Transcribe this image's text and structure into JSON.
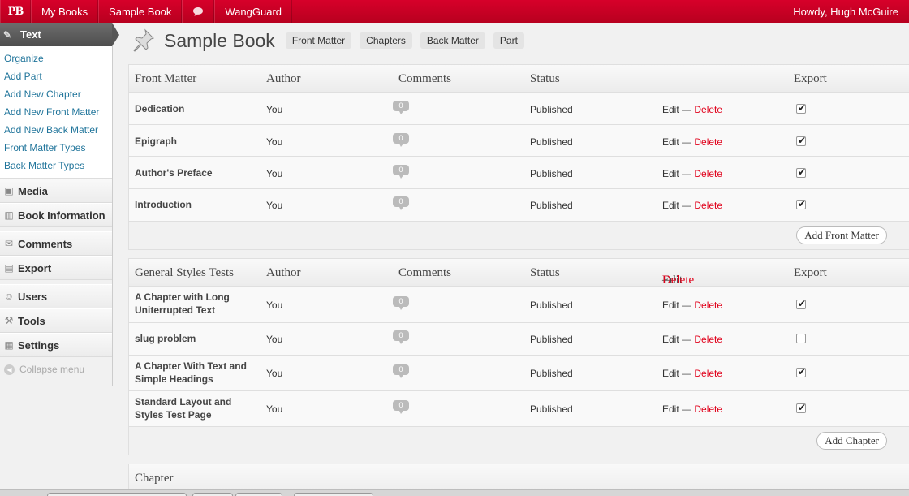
{
  "adminbar": {
    "logo": "PB",
    "my_books": "My Books",
    "sample_book": "Sample Book",
    "wangguard": "WangGuard",
    "howdy": "Howdy, Hugh McGuire"
  },
  "sidebar": {
    "current": "Text",
    "submenu": [
      "Organize",
      "Add Part",
      "Add New Chapter",
      "Add New Front Matter",
      "Add New Back Matter",
      "Front Matter Types",
      "Back Matter Types"
    ],
    "items": [
      {
        "label": "Media",
        "icon": "media-icon"
      },
      {
        "label": "Book Information",
        "icon": "book-icon"
      },
      {
        "label": "Comments",
        "icon": "comments-icon"
      },
      {
        "label": "Export",
        "icon": "export-icon"
      },
      {
        "label": "Users",
        "icon": "users-icon"
      },
      {
        "label": "Tools",
        "icon": "tools-icon"
      },
      {
        "label": "Settings",
        "icon": "settings-icon"
      }
    ],
    "collapse": "Collapse menu"
  },
  "header": {
    "title": "Sample Book",
    "tabs": [
      "Front Matter",
      "Chapters",
      "Back Matter",
      "Part"
    ]
  },
  "front_matter": {
    "columns": {
      "title": "Front Matter",
      "author": "Author",
      "comments": "Comments",
      "status": "Status",
      "export": "Export"
    },
    "rows": [
      {
        "title": "Dedication",
        "author": "You",
        "comments": "0",
        "status": "Published",
        "edit": "Edit",
        "dash": "—",
        "delete": "Delete",
        "export": true
      },
      {
        "title": "Epigraph",
        "author": "You",
        "comments": "0",
        "status": "Published",
        "edit": "Edit",
        "dash": "—",
        "delete": "Delete",
        "export": true
      },
      {
        "title": "Author's Preface",
        "author": "You",
        "comments": "0",
        "status": "Published",
        "edit": "Edit",
        "dash": "—",
        "delete": "Delete",
        "export": true
      },
      {
        "title": "Introduction",
        "author": "You",
        "comments": "0",
        "status": "Published",
        "edit": "Edit",
        "dash": "—",
        "delete": "Delete",
        "export": true
      }
    ],
    "add_button": "Add Front Matter"
  },
  "chapters": {
    "columns": {
      "title": "General Styles Tests",
      "author": "Author",
      "comments": "Comments",
      "status": "Status",
      "edit": "Edit",
      "dash": "—",
      "delete": "Delete",
      "export": "Export"
    },
    "rows": [
      {
        "title": "A Chapter with Long Uniterrupted Text",
        "author": "You",
        "comments": "0",
        "status": "Published",
        "edit": "Edit",
        "dash": "—",
        "delete": "Delete",
        "export": true
      },
      {
        "title": "slug problem",
        "author": "You",
        "comments": "0",
        "status": "Published",
        "edit": "Edit",
        "dash": "—",
        "delete": "Delete",
        "export": false
      },
      {
        "title": "A Chapter With Text and Simple Headings",
        "author": "You",
        "comments": "0",
        "status": "Published",
        "edit": "Edit",
        "dash": "—",
        "delete": "Delete",
        "export": true
      },
      {
        "title": "Standard Layout and Styles Test Page",
        "author": "You",
        "comments": "0",
        "status": "Published",
        "edit": "Edit",
        "dash": "—",
        "delete": "Delete",
        "export": true
      }
    ],
    "add_button": "Add Chapter"
  },
  "next_part": {
    "title": "Chapter"
  },
  "colors": {
    "adminbar": "#c8001f",
    "delete": "#e0001a",
    "link": "#21759b"
  }
}
